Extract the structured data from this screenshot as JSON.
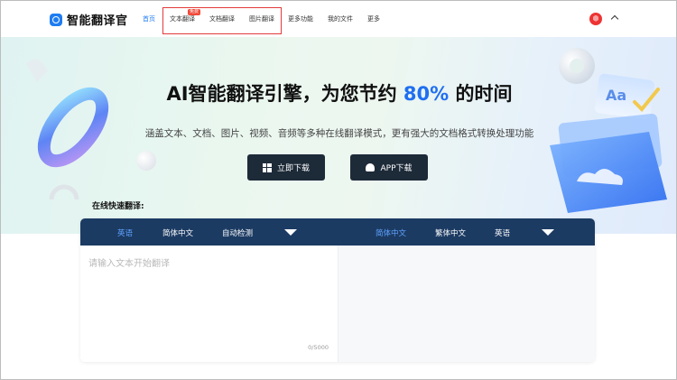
{
  "brand": {
    "name": "智能翻译官"
  },
  "nav": {
    "items": [
      "首页",
      "文本翻译",
      "文档翻译",
      "图片翻译",
      "更多功能",
      "我的文件",
      "更多"
    ],
    "badge": "免费",
    "active_index": 0
  },
  "hero": {
    "title_prefix": "AI智能翻译引擎，为您节约 ",
    "title_accent": "80%",
    "title_suffix": " 的时间",
    "subtitle": "涵盖文本、文档、图片、视频、音频等多种在线翻译模式，更有强大的文档格式转换处理功能",
    "download_button": "立即下载",
    "app_button": "APP下载",
    "card_text_1": "Aa"
  },
  "translator": {
    "title": "在线快速翻译:",
    "source_langs": [
      "英语",
      "简体中文",
      "自动检测"
    ],
    "target_langs": [
      "简体中文",
      "繁体中文",
      "英语"
    ],
    "placeholder": "请输入文本开始翻译",
    "counter": "0/5000"
  },
  "colors": {
    "accent": "#1f6ff2",
    "lang_bar": "#1c3b63",
    "button_dark": "#1d2a38",
    "highlight_red": "#e33b3b"
  }
}
